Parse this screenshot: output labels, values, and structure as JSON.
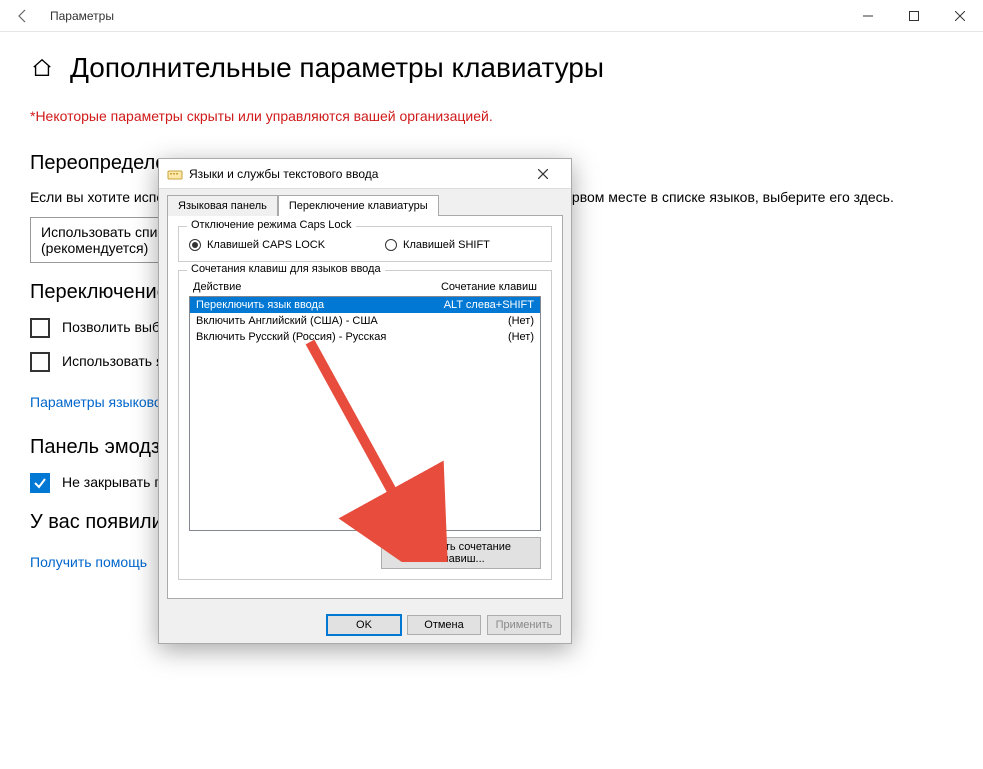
{
  "titlebar": {
    "title": "Параметры"
  },
  "page": {
    "title": "Дополнительные параметры клавиатуры",
    "policy_note": "*Некоторые параметры скрыты или управляются вашей организацией.",
    "section_override": "Переопределение метода ввода по умолчанию",
    "override_text": "Если вы хотите использовать метод ввода, отличный от того, который указан на первом месте в списке языков, выберите его здесь.",
    "dropdown_value": "Использовать список языков (рекомендуется)",
    "section_switch": "Переключение методов ввода",
    "cb1_label": "Позволить выбирать метод ввода для каждого окна приложения",
    "cb2_label": "Использовать языковую панель на рабочем столе, если она доступна",
    "link_lang": "Параметры языковой панели",
    "section_emoji": "Панель эмодзи",
    "cb3_label": "Не закрывать панель автоматически после ввода эмодзи",
    "section_help": "У вас появились вопросы?",
    "link_help": "Получить помощь"
  },
  "dialog": {
    "title": "Языки и службы текстового ввода",
    "tab1": "Языковая панель",
    "tab2": "Переключение клавиатуры",
    "group_caps_title": "Отключение режима Caps Lock",
    "radio_caps": "Клавишей CAPS LOCK",
    "radio_shift": "Клавишей SHIFT",
    "group_hotkeys_title": "Сочетания клавиш для языков ввода",
    "col_action": "Действие",
    "col_combo": "Сочетание клавиш",
    "rows": [
      {
        "action": "Переключить язык ввода",
        "combo": "ALT слева+SHIFT"
      },
      {
        "action": "Включить Английский (США) - США",
        "combo": "(Нет)"
      },
      {
        "action": "Включить Русский (Россия) - Русская",
        "combo": "(Нет)"
      }
    ],
    "change_btn": "Сменить сочетание клавиш...",
    "ok": "OK",
    "cancel": "Отмена",
    "apply": "Применить"
  }
}
